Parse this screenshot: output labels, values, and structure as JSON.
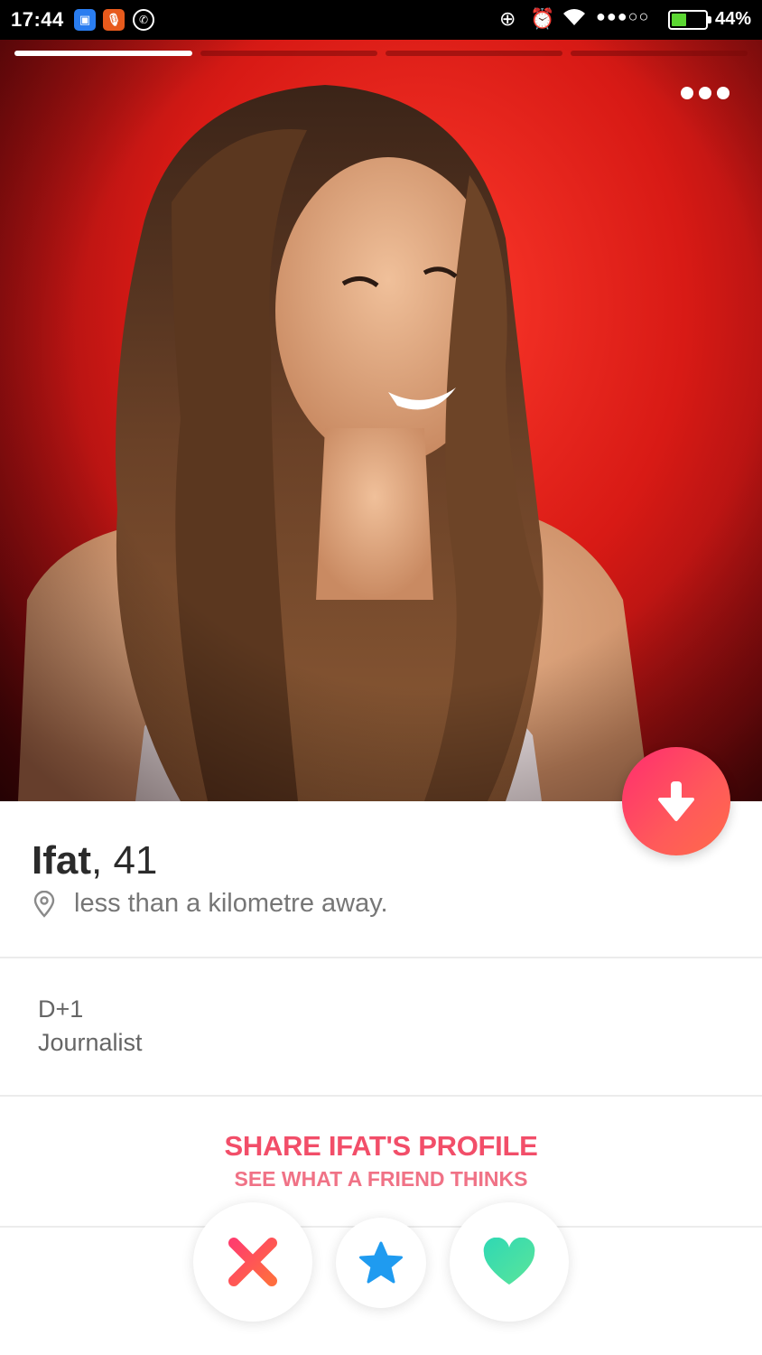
{
  "status_bar": {
    "time": "17:44",
    "battery": "44%",
    "battery_level": 0.44,
    "notification_icons": [
      "app-icon",
      "microphone-app-icon",
      "whatsapp-icon"
    ],
    "system_icons": [
      "rotation-lock-icon",
      "alarm-icon",
      "wifi-icon",
      "signal-icon",
      "battery-icon"
    ]
  },
  "photo": {
    "photo_count": 4,
    "current_photo": 1,
    "background_color": "#d81a15"
  },
  "profile": {
    "name": "Ifat",
    "age": "41",
    "distance": "less than a kilometre away.",
    "job_line1": "D+1",
    "job_line2": "Journalist"
  },
  "share": {
    "title": "SHARE IFAT'S PROFILE",
    "subtitle": "SEE WHAT A FRIEND THINKS"
  },
  "colors": {
    "accent": "#f24e69",
    "nope": "#ff4f5e",
    "star": "#1f9bf0",
    "like": "#3ed9a6"
  }
}
